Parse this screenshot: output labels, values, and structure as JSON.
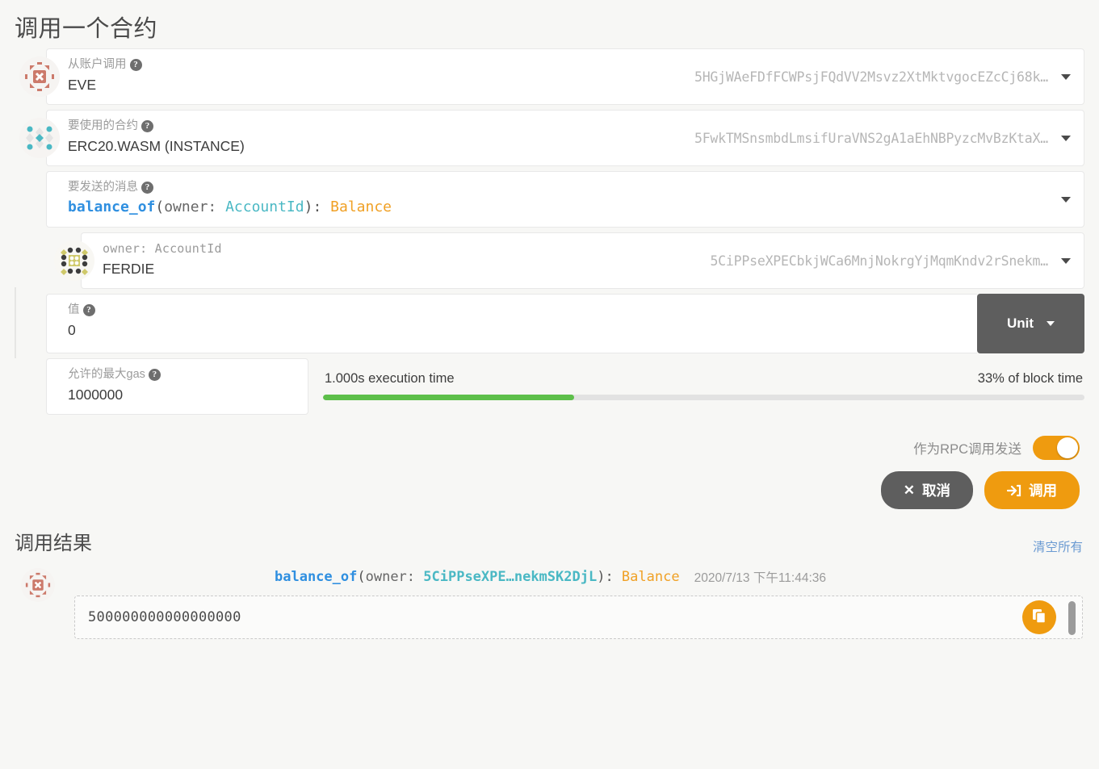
{
  "page": {
    "title": "调用一个合约"
  },
  "form": {
    "from_account": {
      "label": "从账户调用",
      "value": "EVE",
      "address": "5HGjWAeFDfFCWPsjFQdVV2Msvz2XtMktvgocEZcCj68k…",
      "icon": "identicon-eve",
      "help": "help-icon"
    },
    "contract": {
      "label": "要使用的合约",
      "value": "ERC20.WASM (INSTANCE)",
      "address": "5FwkTMSnsmbdLmsifUraVNS2gA1aEhNBPyzcMvBzKtaX…",
      "icon": "identicon-contract",
      "help": "help-icon"
    },
    "message": {
      "label": "要发送的消息",
      "fn": "balance_of",
      "open_paren": "(",
      "arg": "owner: ",
      "arg_type": "AccountId",
      "close_paren": "): ",
      "return_type": "Balance"
    },
    "param_owner": {
      "label": "owner: AccountId",
      "value": "FERDIE",
      "address": "5CiPPseXPECbkjWCa6MnjNokrgYjMqmKndv2rSnekm…",
      "icon": "identicon-ferdie"
    },
    "value_field": {
      "label": "值",
      "value": "0",
      "unit_label": "Unit"
    },
    "gas": {
      "label": "允许的最大gas",
      "value": "1000000"
    },
    "execution": {
      "time_label": "1.000s execution time",
      "block_label": "33% of block time",
      "percent": 33,
      "bar_color": "#5dbf4a"
    },
    "rpc_toggle": {
      "label": "作为RPC调用发送",
      "enabled": true,
      "on_color": "#ef9b0f"
    },
    "buttons": {
      "cancel": "取消",
      "cancel_icon": "✕",
      "call": "调用",
      "call_icon": "→]"
    }
  },
  "results": {
    "title": "调用结果",
    "clear_all": "清空所有",
    "items": [
      {
        "fn": "balance_of",
        "open_paren": "(",
        "arg": "owner: ",
        "account": "5CiPPseXPE…nekmSK2DjL",
        "close_paren": "): ",
        "return_type": "Balance",
        "timestamp": "2020/7/13 下午11:44:36",
        "value": "500000000000000000",
        "copy_icon": "copy-icon"
      }
    ]
  },
  "colors": {
    "accent": "#ef9b0f",
    "fn": "#2f8fe0",
    "type": "#4ab8c4",
    "return": "#f0a024",
    "dark_button": "#5e5e5e",
    "link": "#6b9bd2",
    "progress": "#5dbf4a"
  }
}
